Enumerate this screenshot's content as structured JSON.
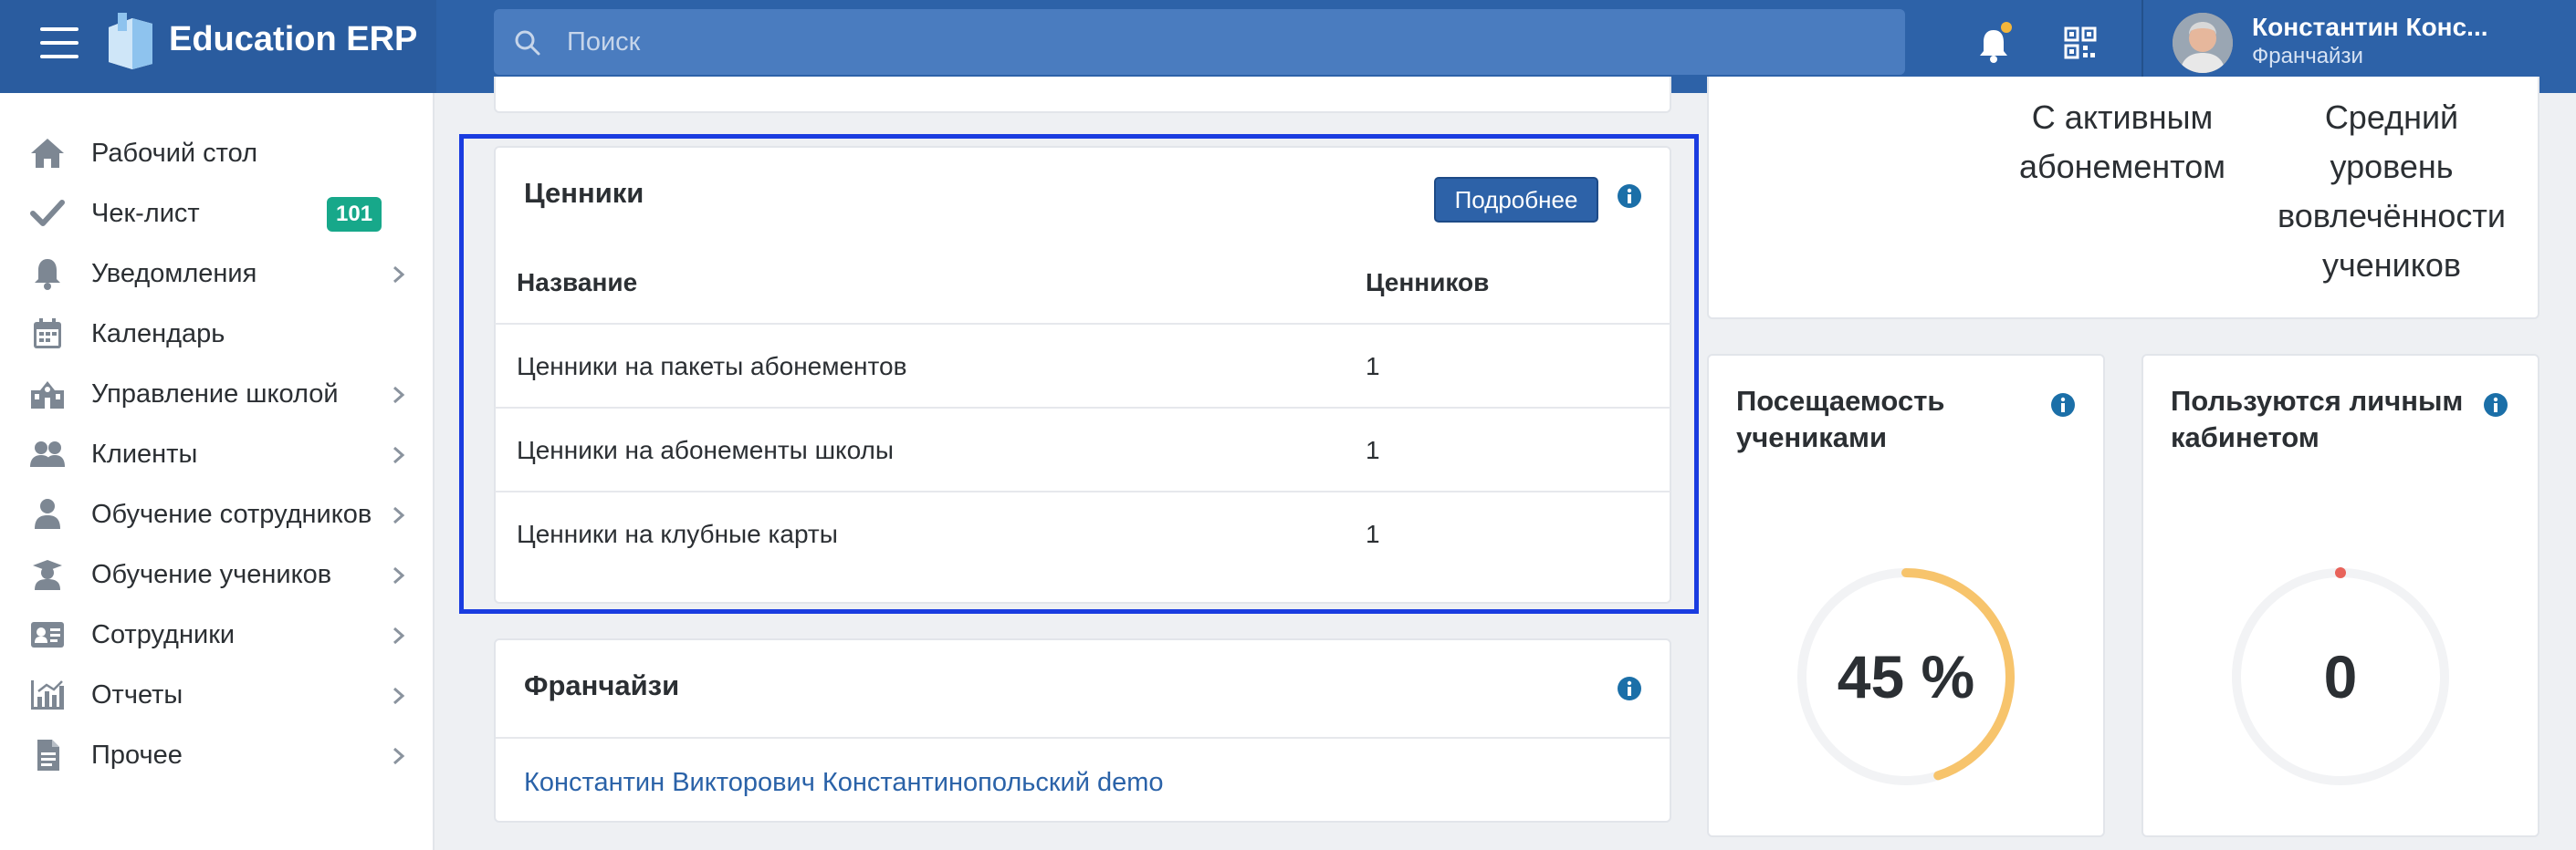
{
  "app": {
    "brand": "Education ERP"
  },
  "search": {
    "placeholder": "Поиск"
  },
  "user": {
    "name": "Константин Конс...",
    "role": "Франчайзи"
  },
  "sidebar": {
    "items": [
      {
        "label": "Рабочий стол",
        "icon": "home-icon",
        "has_submenu": false
      },
      {
        "label": "Чек-лист",
        "icon": "check-icon",
        "badge": "101",
        "has_submenu": false
      },
      {
        "label": "Уведомления",
        "icon": "bell-icon",
        "has_submenu": true
      },
      {
        "label": "Календарь",
        "icon": "calendar-icon",
        "has_submenu": false
      },
      {
        "label": "Управление школой",
        "icon": "school-icon",
        "has_submenu": true
      },
      {
        "label": "Клиенты",
        "icon": "clients-icon",
        "has_submenu": true
      },
      {
        "label": "Обучение сотрудников",
        "icon": "employee-training-icon",
        "has_submenu": true
      },
      {
        "label": "Обучение учеников",
        "icon": "student-training-icon",
        "has_submenu": true
      },
      {
        "label": "Сотрудники",
        "icon": "employees-icon",
        "has_submenu": true
      },
      {
        "label": "Отчеты",
        "icon": "reports-icon",
        "has_submenu": true
      },
      {
        "label": "Прочее",
        "icon": "document-icon",
        "has_submenu": true
      }
    ]
  },
  "price_tags": {
    "title": "Ценники",
    "more_button": "Подробнее",
    "columns": [
      "Название",
      "Ценников"
    ],
    "rows": [
      {
        "name": "Ценники на пакеты абонементов",
        "count": "1"
      },
      {
        "name": "Ценники на абонементы школы",
        "count": "1"
      },
      {
        "name": "Ценники на клубные карты",
        "count": "1"
      }
    ]
  },
  "franchisee": {
    "title": "Франчайзи",
    "link": "Константин Викторович Константинопольский demo"
  },
  "stats_top": {
    "with_active_subscription": "С активным абонементом",
    "avg_engagement": "Средний уровень вовлечённости учеников"
  },
  "attendance": {
    "title": "Посещаемость учениками",
    "value_text": "45 %",
    "percent": 45
  },
  "personal_cabinet": {
    "title": "Пользуются личным кабинетом",
    "value_text": "0",
    "percent": 0
  },
  "colors": {
    "accent": "#2d62a8",
    "badge": "#17a88a",
    "gauge": "#f7c46c",
    "highlight": "#1a3ce0",
    "info": "#1b6fa8"
  }
}
